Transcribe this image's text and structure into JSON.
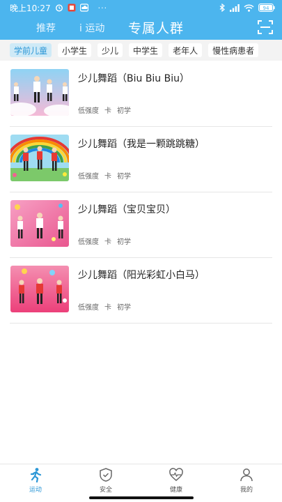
{
  "status": {
    "time": "晚上10:27",
    "battery": "94"
  },
  "nav": {
    "tabs": [
      "推荐",
      "i 运动",
      "专属人群"
    ]
  },
  "categories": [
    "学前儿童",
    "小学生",
    "少儿",
    "中学生",
    "老年人",
    "慢性病患者"
  ],
  "items": [
    {
      "title": "少儿舞蹈（Biu Biu Biu）",
      "intensity": "低强度",
      "unit": "卡",
      "level": "初学"
    },
    {
      "title": "少儿舞蹈（我是一颗跳跳糖）",
      "intensity": "低强度",
      "unit": "卡",
      "level": "初学"
    },
    {
      "title": "少儿舞蹈（宝贝宝贝）",
      "intensity": "低强度",
      "unit": "卡",
      "level": "初学"
    },
    {
      "title": "少儿舞蹈（阳光彩虹小白马）",
      "intensity": "低强度",
      "unit": "卡",
      "level": "初学"
    }
  ],
  "bottom_nav": [
    "运动",
    "安全",
    "健康",
    "我的"
  ],
  "colors": {
    "header": "#4cb5ee",
    "accent": "#2c97d6",
    "chip_active_bg": "#cfeaf7"
  }
}
